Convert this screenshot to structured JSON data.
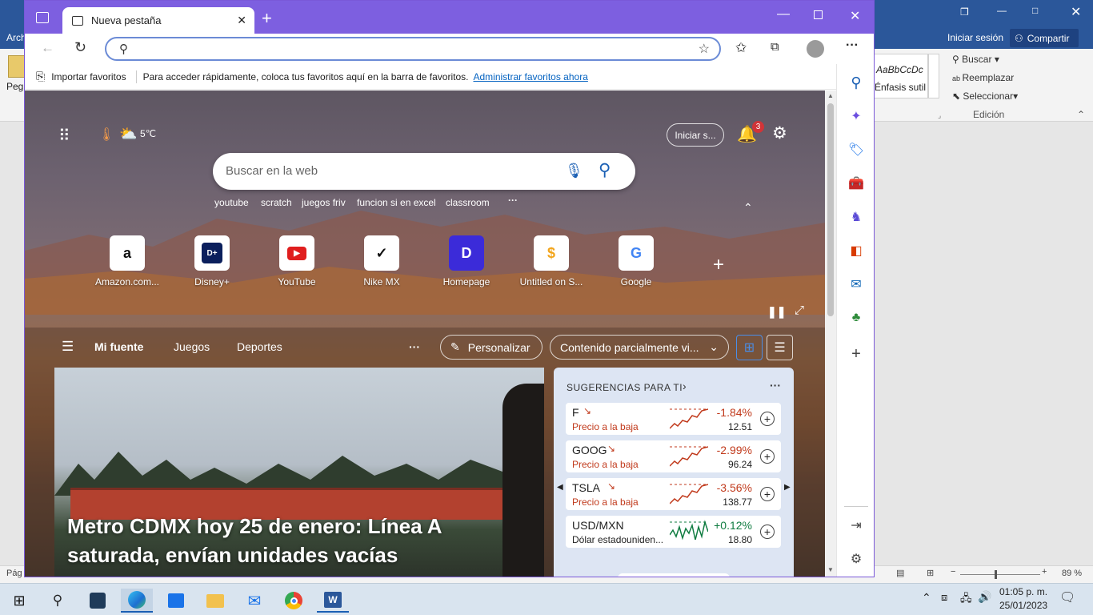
{
  "word": {
    "menu_partial": "Arch",
    "paste_partial": "Peg",
    "signin": "Iniciar sesión",
    "share": "Compartir",
    "style_preview": "AaBbCcDc",
    "style_name": "Énfasis sutil",
    "find": "Buscar",
    "replace": "Reemplazar",
    "select": "Seleccionar",
    "editing_group": "Edición",
    "status_page": "Pág",
    "zoom": "89 %"
  },
  "edge": {
    "tab_title": "Nueva pestaña",
    "address_value": "",
    "favbar": {
      "import": "Importar favoritos",
      "hint": "Para acceder rápidamente, coloca tus favoritos aquí en la barra de favoritos.",
      "manage": "Administrar favoritos ahora"
    },
    "newtab": {
      "temperature": "5℃",
      "signin": "Iniciar s...",
      "notif_count": "3",
      "search_placeholder": "Buscar en la web",
      "suggestions": [
        "youtube",
        "scratch",
        "juegos friv",
        "funcion si en excel",
        "classroom"
      ],
      "quick_links": [
        {
          "label": "Amazon.com...",
          "glyph": "a"
        },
        {
          "label": "Disney+",
          "glyph": "D+"
        },
        {
          "label": "YouTube",
          "glyph": "▶"
        },
        {
          "label": "Nike MX",
          "glyph": "✓"
        },
        {
          "label": "Homepage",
          "glyph": "D"
        },
        {
          "label": "Untitled on S...",
          "glyph": "$"
        },
        {
          "label": "Google",
          "glyph": "G"
        }
      ],
      "nav": {
        "my_feed": "Mi fuente",
        "games": "Juegos",
        "sports": "Deportes"
      },
      "personalize": "Personalizar",
      "content_filter": "Contenido parcialmente vi...",
      "headline": "Metro CDMX hoy 25 de enero: Línea A saturada, envían unidades vacías",
      "suggestions_title": "SUGERENCIAS PARA TI",
      "stocks": [
        {
          "symbol": "F",
          "sub": "Precio a la baja",
          "change": "-1.84%",
          "price": "12.51",
          "trend": "down"
        },
        {
          "symbol": "GOOG",
          "sub": "Precio a la baja",
          "change": "-2.99%",
          "price": "96.24",
          "trend": "down"
        },
        {
          "symbol": "TSLA",
          "sub": "Precio a la baja",
          "change": "-3.56%",
          "price": "138.77",
          "trend": "down"
        },
        {
          "symbol": "USD/MXN",
          "sub": "Dólar estadouniden...",
          "change": "+0.12%",
          "price": "18.80",
          "trend": "up"
        }
      ]
    }
  },
  "taskbar": {
    "time": "01:05 p. m.",
    "date": "25/01/2023"
  },
  "colors": {
    "edge_frame": "#7d5fe0",
    "word_blue": "#2b579a",
    "negative": "#c13a1c",
    "positive": "#107c41"
  }
}
